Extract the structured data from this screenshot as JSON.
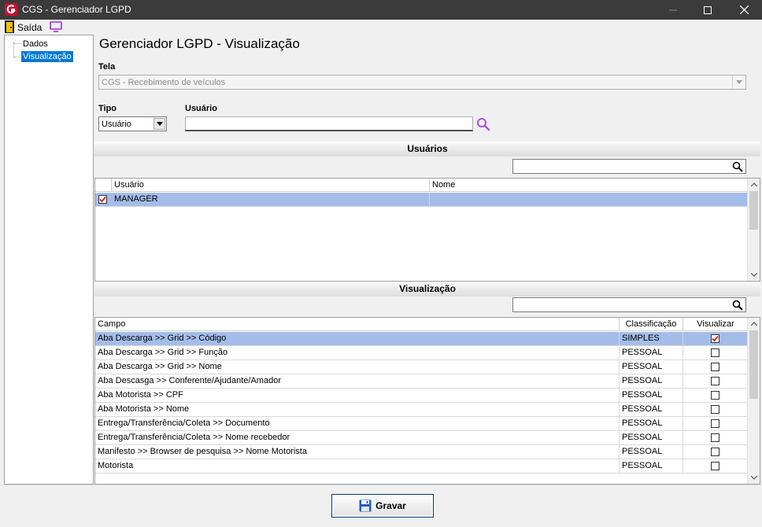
{
  "window": {
    "title": "CGS - Gerenciador LGPD"
  },
  "menu": {
    "exit_label": "Saída"
  },
  "tree": {
    "items": [
      {
        "label": "Dados"
      },
      {
        "label": "Visualização"
      }
    ]
  },
  "page": {
    "title": "Gerenciador LGPD - Visualização"
  },
  "form": {
    "tela_label": "Tela",
    "tela_value": "CGS - Recebimento de veículos",
    "tipo_label": "Tipo",
    "tipo_value": "Usuário",
    "usuario_label": "Usuário",
    "usuario_value": ""
  },
  "usuarios_section": {
    "title": "Usuários",
    "filter_value": "",
    "columns": [
      "Usuário",
      "Nome"
    ],
    "rows": [
      {
        "checked": true,
        "usuario": "MANAGER",
        "nome": ""
      }
    ]
  },
  "visualizacao_section": {
    "title": "Visualização",
    "filter_value": "",
    "columns": [
      "Campo",
      "Classificação",
      "Visualizar"
    ],
    "rows": [
      {
        "campo": "Aba Descarga >> Grid >> Código",
        "classificacao": "SIMPLES",
        "visualizar": true
      },
      {
        "campo": "Aba Descarga >> Grid >> Função",
        "classificacao": "PESSOAL",
        "visualizar": false
      },
      {
        "campo": "Aba Descarga >> Grid >> Nome",
        "classificacao": "PESSOAL",
        "visualizar": false
      },
      {
        "campo": "Aba Descasga >> Conferente/Ajudante/Amador",
        "classificacao": "PESSOAL",
        "visualizar": false
      },
      {
        "campo": "Aba Motorista >> CPF",
        "classificacao": "PESSOAL",
        "visualizar": false
      },
      {
        "campo": "Aba Motorista >> Nome",
        "classificacao": "PESSOAL",
        "visualizar": false
      },
      {
        "campo": "Entrega/Transferência/Coleta >> Documento",
        "classificacao": "PESSOAL",
        "visualizar": false
      },
      {
        "campo": "Entrega/Transferência/Coleta >> Nome recebedor",
        "classificacao": "PESSOAL",
        "visualizar": false
      },
      {
        "campo": "Manifesto >> Browser de pesquisa >> Nome Motorista",
        "classificacao": "PESSOAL",
        "visualizar": false
      },
      {
        "campo": "Motorista",
        "classificacao": "PESSOAL",
        "visualizar": false
      }
    ]
  },
  "actions": {
    "save_label": "Gravar"
  },
  "colors": {
    "titlebar": "#3b3b3b",
    "selection_row": "#a4bde8",
    "tree_selection": "#0078d7",
    "accent_purple": "#9b30d9",
    "check_red": "#d11a1a"
  }
}
